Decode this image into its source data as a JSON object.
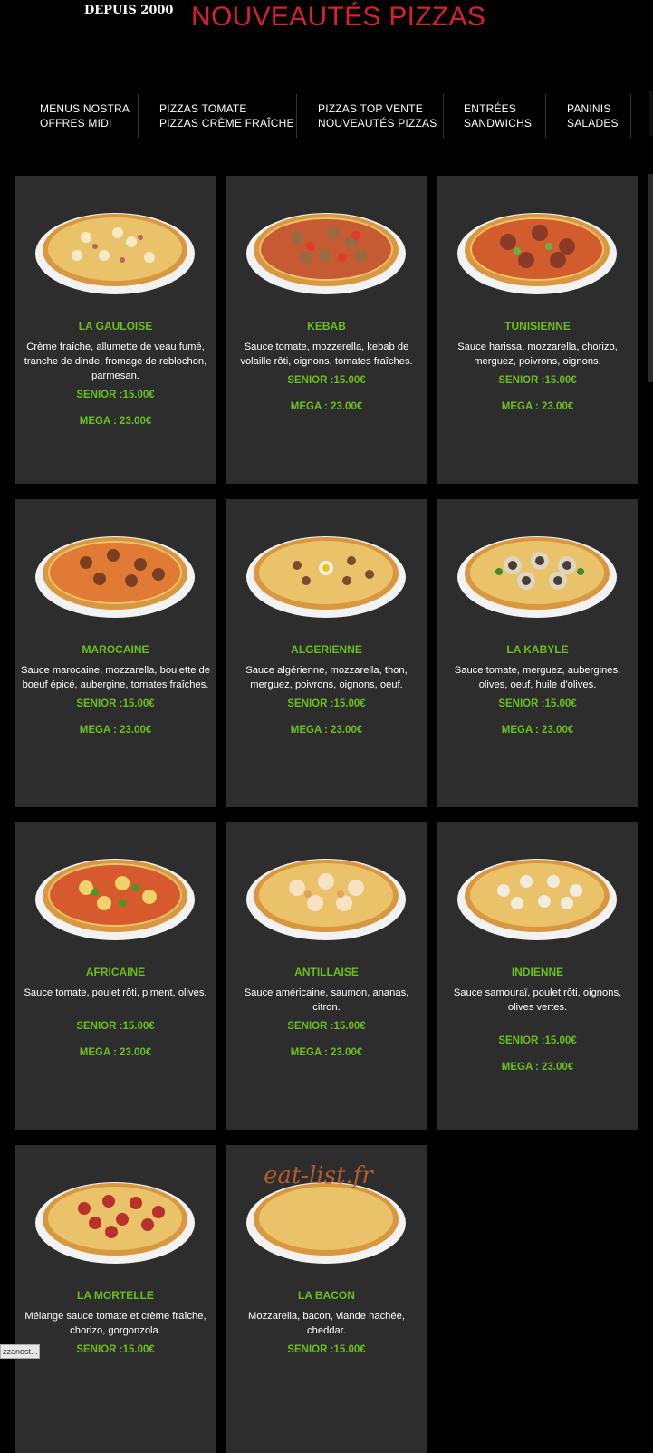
{
  "header": {
    "since": "DEPUIS 2000",
    "title": "NOUVEAUTÉS PIZZAS"
  },
  "nav": [
    {
      "line1": "MENUS NOSTRA",
      "line2": "OFFRES MIDI"
    },
    {
      "line1": "PIZZAS TOMATE",
      "line2": "PIZZAS CRÈME FRAÎCHE"
    },
    {
      "line1": "PIZZAS TOP VENTE",
      "line2": "NOUVEAUTÉS PIZZAS"
    },
    {
      "line1": "ENTRÉES",
      "line2": "SANDWICHS"
    },
    {
      "line1": "PANINIS",
      "line2": "SALADES"
    }
  ],
  "pizzas": [
    {
      "name": "LA GAULOISE",
      "desc": "Crème fraîche, allumette de veau fumé, tranche de dinde, fromage de reblochon, parmesan.",
      "senior": "SENIOR :15.00€",
      "mega": "MEGA : 23.00€",
      "topping": "white"
    },
    {
      "name": "KEBAB",
      "desc": "Sauce tomate, mozzerella, kebab de volaille rôti, oignons, tomates fraîches.",
      "senior": "SENIOR :15.00€",
      "mega": "MEGA : 23.00€",
      "topping": "kebab"
    },
    {
      "name": "TUNISIENNE",
      "desc": "Sauce harissa, mozzarella, chorizo, merguez, poivrons, oignons.",
      "senior": "SENIOR :15.00€",
      "mega": "MEGA : 23.00€",
      "topping": "merguez"
    },
    {
      "name": "MAROCAINE",
      "desc": "Sauce marocaine, mozzarella, boulette de boeuf épicé, aubergine, tomates fraîches.",
      "senior": "SENIOR :15.00€",
      "mega": "MEGA : 23.00€",
      "topping": "meatball"
    },
    {
      "name": "ALGERIENNE",
      "desc": "Sauce algérienne, mozzarella, thon, merguez, poivrons, oignons, oeuf.",
      "senior": "SENIOR :15.00€",
      "mega": "MEGA : 23.00€",
      "topping": "egg"
    },
    {
      "name": "LA KABYLE",
      "desc": "Sauce tomate, merguez, aubergines, olives, oeuf, huile d'olives.",
      "senior": "SENIOR :15.00€",
      "mega": "MEGA : 23.00€",
      "topping": "eggplant"
    },
    {
      "name": "AFRICAINE",
      "desc": "Sauce tomate, poulet rôti, piment, olives.",
      "senior": "SENIOR :15.00€",
      "mega": "MEGA : 23.00€",
      "topping": "pepper"
    },
    {
      "name": "ANTILLAISE",
      "desc": "Sauce américaine, saumon, ananas, citron.",
      "senior": "SENIOR :15.00€",
      "mega": "MEGA : 23.00€",
      "topping": "salmon"
    },
    {
      "name": "INDIENNE",
      "desc": "Sauce samouraï, poulet rôti, oignons, olives vertes.",
      "senior": "SENIOR :15.00€",
      "mega": "MEGA : 23.00€",
      "topping": "chicken"
    },
    {
      "name": "LA MORTELLE",
      "desc": "Mélange sauce tomate et crème fraîche, chorizo, gorgonzola.",
      "senior": "SENIOR :15.00€",
      "mega": "",
      "topping": "pepperoni"
    },
    {
      "name": "LA BACON",
      "desc": "Mozzarella, bacon, viande hachée, cheddar.",
      "senior": "SENIOR :15.00€",
      "mega": "",
      "topping": "none"
    }
  ],
  "watermark": "eat-list.fr",
  "status": "zzanost..."
}
